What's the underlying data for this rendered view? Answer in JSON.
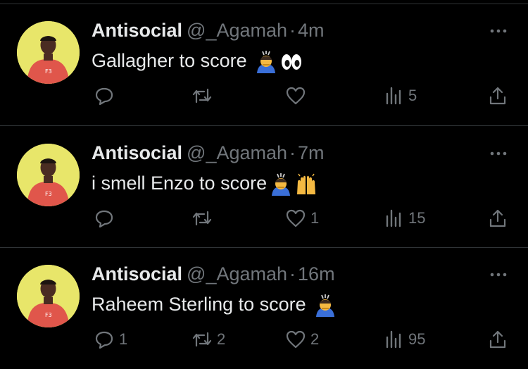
{
  "tweets": [
    {
      "name": "Antisocial",
      "handle": "@_Agamah",
      "separator": "·",
      "time": "4m",
      "text": "Gallagher to score",
      "emojis": [
        "bowing-person-emoji",
        "eyes-emoji"
      ],
      "replies": "",
      "retweets": "",
      "likes": "",
      "views": "5"
    },
    {
      "name": "Antisocial",
      "handle": "@_Agamah",
      "separator": "·",
      "time": "7m",
      "text": "i smell Enzo to score",
      "emojis": [
        "bowing-person-emoji",
        "raised-hands-emoji"
      ],
      "replies": "",
      "retweets": "",
      "likes": "1",
      "views": "15"
    },
    {
      "name": "Antisocial",
      "handle": "@_Agamah",
      "separator": "·",
      "time": "16m",
      "text": "Raheem Sterling to score",
      "emojis": [
        "bowing-person-emoji"
      ],
      "replies": "1",
      "retweets": "2",
      "likes": "2",
      "views": "95"
    }
  ],
  "icons": {
    "reply": "reply-icon",
    "retweet": "retweet-icon",
    "like": "heart-icon",
    "views": "views-icon",
    "share": "share-icon",
    "more": "more-options-icon"
  },
  "colors": {
    "background": "#000000",
    "text": "#e7e9ea",
    "muted": "#71767b",
    "divider": "#2f3336",
    "avatar_bg": "#e8e66a",
    "hoodie": "#e0564b"
  }
}
